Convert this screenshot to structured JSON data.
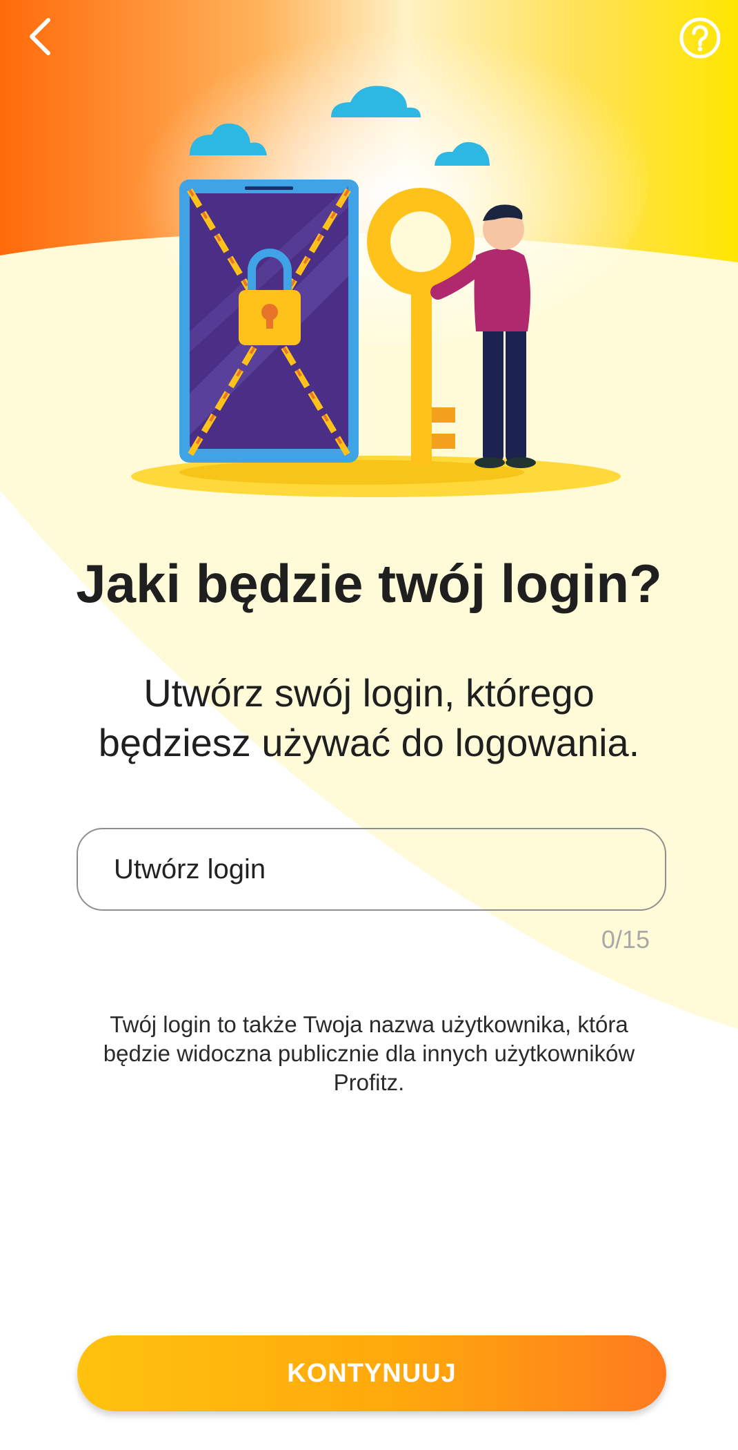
{
  "header": {
    "back_icon": "chevron-left-icon",
    "help_icon": "question-circle-icon"
  },
  "illustration": {
    "description_icon": "locked-phone-key-illustration"
  },
  "main": {
    "title": "Jaki będzie twój login?",
    "subtitle_line1": "Utwórz swój login, którego",
    "subtitle_line2": "będziesz używać do logowania.",
    "login_placeholder": "Utwórz login",
    "login_value": "",
    "char_count": "0/15",
    "info_line1": "Twój login to także Twoja nazwa użytkownika, która",
    "info_line2": "będzie widoczna publicznie dla innych użytkowników",
    "info_line3": "Profitz."
  },
  "footer": {
    "continue_label": "KONTYNUUJ"
  },
  "colors": {
    "accent_orange": "#ff7a1f",
    "accent_yellow": "#ffc20e",
    "pale_yellow": "#fffbd8"
  }
}
